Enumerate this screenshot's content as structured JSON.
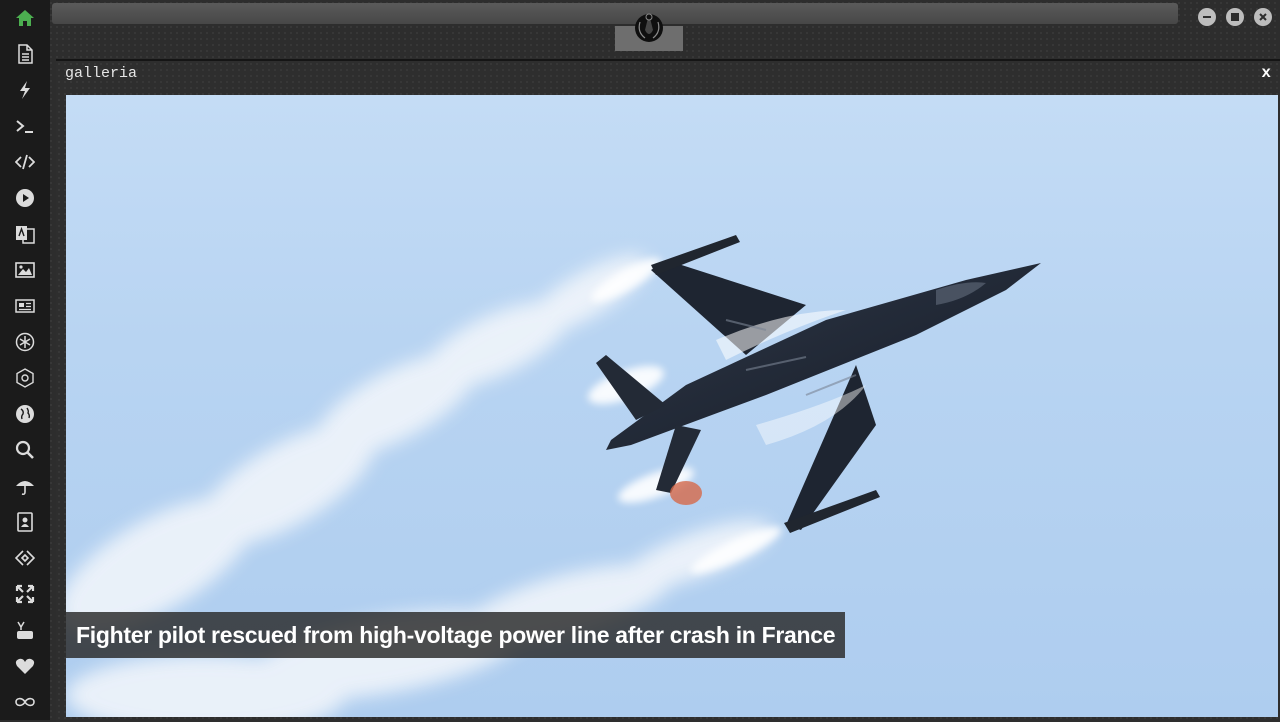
{
  "sidebar": {
    "items": [
      {
        "icon": "home-icon",
        "color": "#4caf50"
      },
      {
        "icon": "document-icon"
      },
      {
        "icon": "lightning-icon"
      },
      {
        "icon": "terminal-icon"
      },
      {
        "icon": "code-icon"
      },
      {
        "icon": "play-icon"
      },
      {
        "icon": "translate-icon"
      },
      {
        "icon": "image-icon"
      },
      {
        "icon": "newspaper-icon"
      },
      {
        "icon": "rebel-icon"
      },
      {
        "icon": "empire-icon"
      },
      {
        "icon": "globe-icon"
      },
      {
        "icon": "search-icon"
      },
      {
        "icon": "umbrella-icon"
      },
      {
        "icon": "contacts-icon"
      },
      {
        "icon": "diamond-code-icon"
      },
      {
        "icon": "expand-icon"
      },
      {
        "icon": "youtube-icon"
      },
      {
        "icon": "heart-icon"
      },
      {
        "icon": "infinity-icon"
      }
    ]
  },
  "window": {
    "title": "galleria",
    "close_label": "x"
  },
  "gallery": {
    "caption": "Fighter pilot rescued from high-voltage power line after crash in France"
  },
  "colors": {
    "accent": "#4caf50",
    "sidebar_bg": "#1b1b1b",
    "sky": "#b8d4f2"
  }
}
